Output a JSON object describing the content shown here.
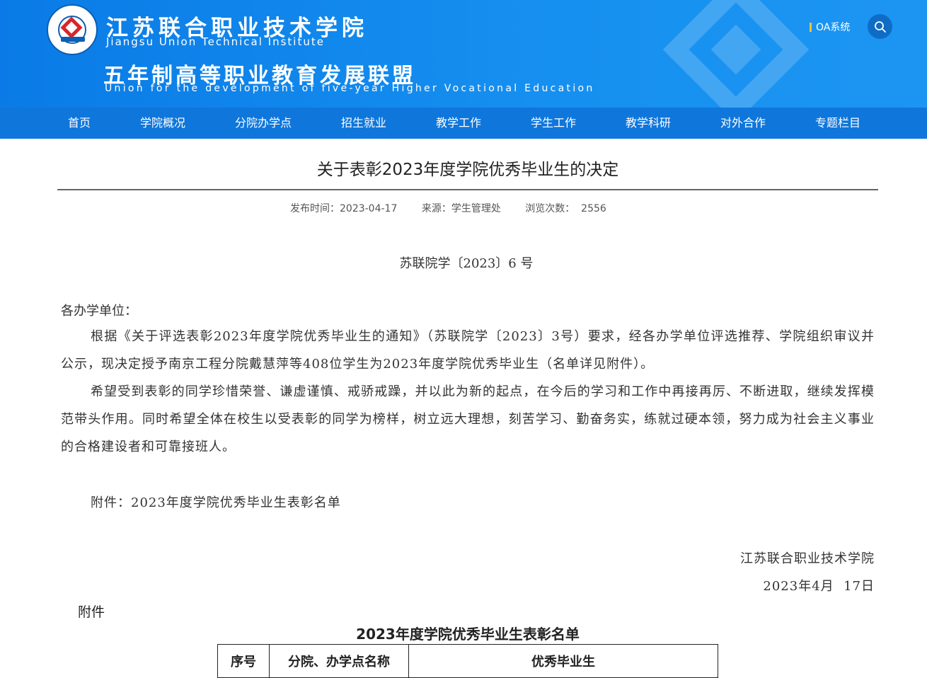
{
  "header": {
    "school_name_cn": "江苏联合职业技术学院",
    "school_name_en": "Jiangsu Union Technical Institute",
    "union_name_cn": "五年制高等职业教育发展联盟",
    "union_name_en": "Union for the development of five-year Higher Vocational Education",
    "oa_label": "OA系统",
    "logo_icon": "college-seal-logo",
    "search_icon": "search-icon"
  },
  "colors": {
    "header_bg": "#1690f0",
    "nav_bg": "#0f76db",
    "accent": "#f3c343"
  },
  "nav": {
    "items": [
      {
        "label": "首页"
      },
      {
        "label": "学院概况"
      },
      {
        "label": "分院办学点"
      },
      {
        "label": "招生就业"
      },
      {
        "label": "教学工作"
      },
      {
        "label": "学生工作"
      },
      {
        "label": "教学科研"
      },
      {
        "label": "对外合作"
      },
      {
        "label": "专题栏目"
      }
    ]
  },
  "article": {
    "title": "关于表彰2023年度学院优秀毕业生的决定",
    "publish_time": "发布时间：2023-04-17",
    "source": "来源：学生管理处",
    "views": "浏览次数：  2556",
    "doc_number": "苏联院学〔2023〕6 号",
    "salutation": "各办学单位：",
    "paragraphs": [
      "根据《关于评选表彰2023年度学院优秀毕业生的通知》（苏联院学〔2023〕3号）要求，经各办学单位评选推荐、学院组织审议并公示，现决定授予南京工程分院戴慧萍等408位学生为2023年度学院优秀毕业生（名单详见附件）。",
      "希望受到表彰的同学珍惜荣誉、谦虚谨慎、戒骄戒躁，并以此为新的起点，在今后的学习和工作中再接再厉、不断进取，继续发挥模范带头作用。同时希望全体在校生以受表彰的同学为榜样，树立远大理想，刻苦学习、勤奋务实，练就过硬本领，努力成为社会主义事业的合格建设者和可靠接班人。"
    ],
    "attachment_line": "附件：2023年度学院优秀毕业生表彰名单",
    "signature_org": "江苏联合职业技术学院",
    "signature_date": "2023年4月  17日"
  },
  "attachment": {
    "label": "附件",
    "title": "2023年度学院优秀毕业生表彰名单",
    "table_headers": [
      "序号",
      "分院、办学点名称",
      "优秀毕业生"
    ]
  }
}
